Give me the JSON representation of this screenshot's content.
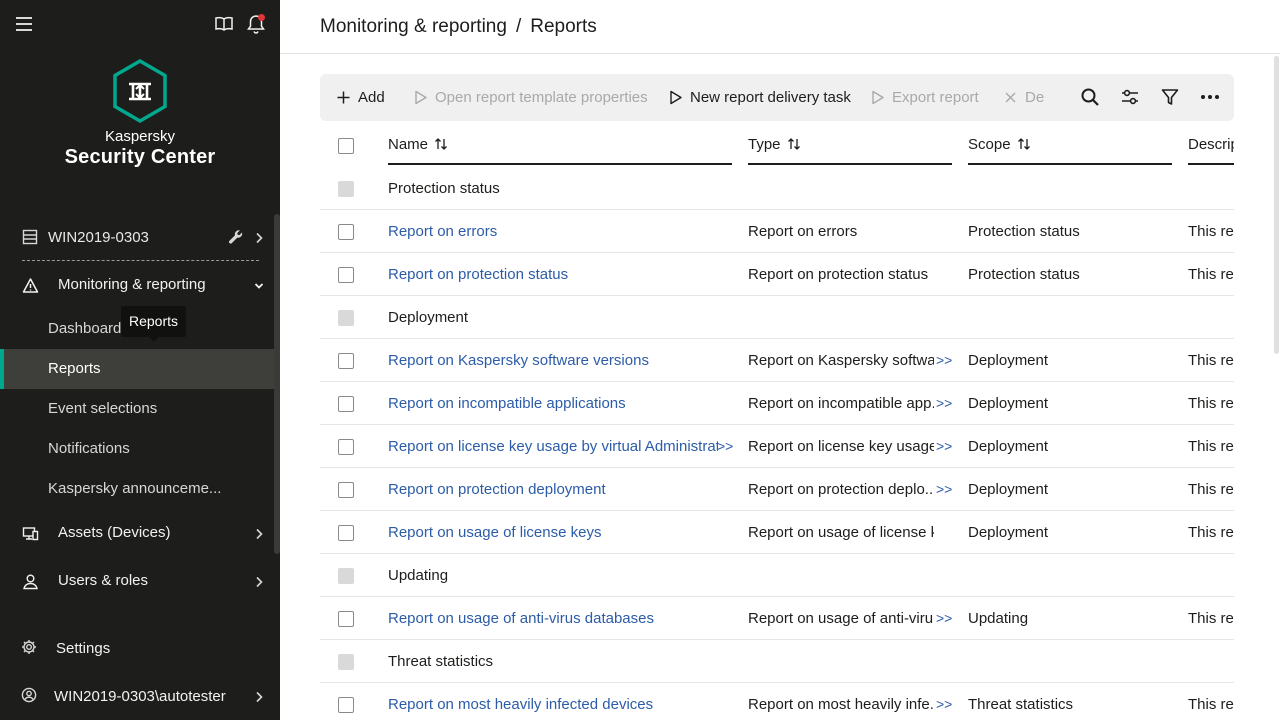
{
  "app": {
    "brand": "Kaspersky",
    "product": "Security Center"
  },
  "sidebar": {
    "server": "WIN2019-0303",
    "monitoring": "Monitoring & reporting",
    "sub_items": [
      "Dashboard",
      "Reports",
      "Event selections",
      "Notifications",
      "Kaspersky announceme..."
    ],
    "active_item": "Reports",
    "tooltip": "Reports",
    "assets": "Assets (Devices)",
    "users": "Users & roles",
    "settings": "Settings",
    "account": "WIN2019-0303\\autotester"
  },
  "header": {
    "crumb1": "Monitoring & reporting",
    "separator": "/",
    "crumb2": "Reports"
  },
  "toolbar": {
    "add": "Add",
    "open_props": "Open report template properties",
    "new_task": "New report delivery task",
    "export": "Export report",
    "delete": "De"
  },
  "table": {
    "columns": [
      "Name",
      "Type",
      "Scope",
      "Descripti"
    ],
    "expand_marker": ">>",
    "rows": [
      {
        "kind": "group",
        "name": "Protection status"
      },
      {
        "kind": "item",
        "name": "Report on errors",
        "type": "Report on errors",
        "scope": "Protection status",
        "desc": "This rep"
      },
      {
        "kind": "item",
        "name": "Report on protection status",
        "type": "Report on protection status",
        "scope": "Protection status",
        "desc": "This rep"
      },
      {
        "kind": "group",
        "name": "Deployment"
      },
      {
        "kind": "item",
        "name": "Report on Kaspersky software versions",
        "type": "Report on Kaspersky softwa...",
        "type_more": true,
        "scope": "Deployment",
        "desc": "This rep"
      },
      {
        "kind": "item",
        "name": "Report on incompatible applications",
        "type": "Report on incompatible app...",
        "type_more": true,
        "scope": "Deployment",
        "desc": "This rep"
      },
      {
        "kind": "item",
        "name": "Report on license key usage by virtual Administrati...",
        "name_more": true,
        "type": "Report on license key usage...",
        "type_more": true,
        "scope": "Deployment",
        "desc": "This rep"
      },
      {
        "kind": "item",
        "name": "Report on protection deployment",
        "type": "Report on protection deplo...",
        "type_more": true,
        "scope": "Deployment",
        "desc": "This rep"
      },
      {
        "kind": "item",
        "name": "Report on usage of license keys",
        "type": "Report on usage of license keys",
        "scope": "Deployment",
        "desc": "This rep"
      },
      {
        "kind": "group",
        "name": "Updating"
      },
      {
        "kind": "item",
        "name": "Report on usage of anti-virus databases",
        "type": "Report on usage of anti-viru...",
        "type_more": true,
        "scope": "Updating",
        "desc": "This rep"
      },
      {
        "kind": "group",
        "name": "Threat statistics"
      },
      {
        "kind": "item",
        "name": "Report on most heavily infected devices",
        "type": "Report on most heavily infe...",
        "type_more": true,
        "scope": "Threat statistics",
        "desc": "This rep"
      }
    ]
  },
  "colors": {
    "sidebar_bg": "#1d1d1b",
    "accent": "#00a88e",
    "link": "#2c5ca8",
    "notification_dot": "#e3343a"
  }
}
